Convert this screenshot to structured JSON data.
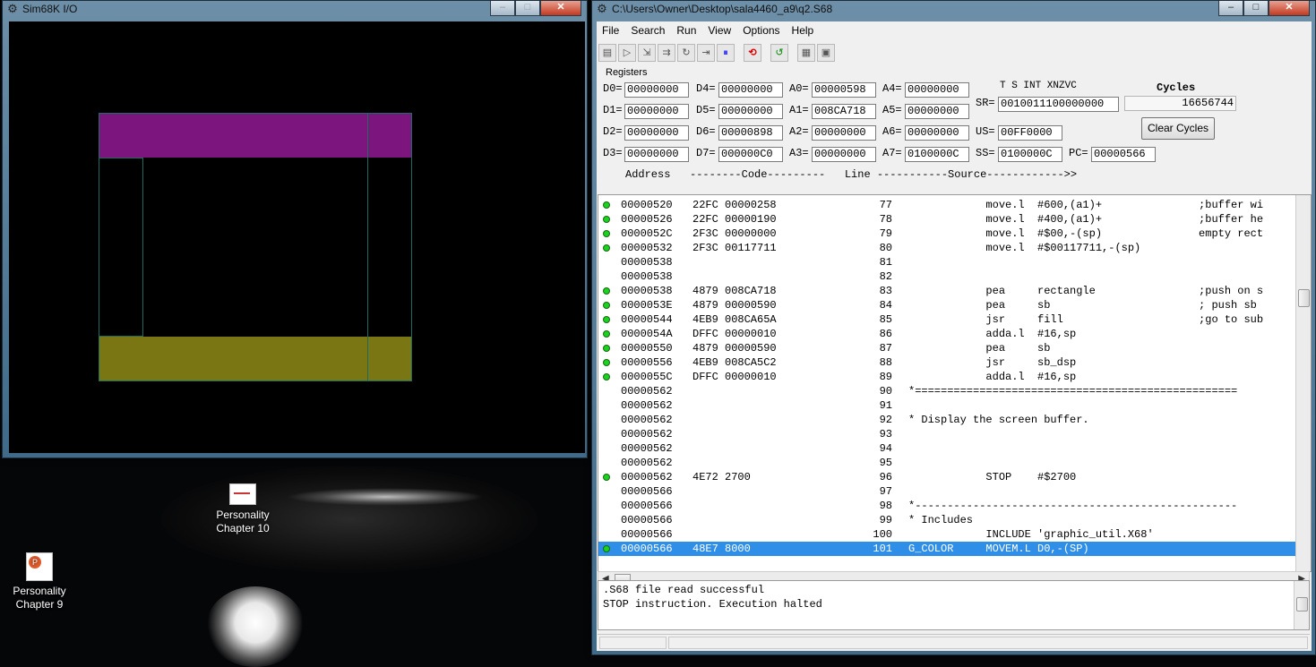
{
  "io_window": {
    "title": "Sim68K I/O",
    "colors": {
      "magenta": "#7d157f",
      "olive": "#7a7613",
      "teal_line": "#1c6b5f"
    }
  },
  "editor_window": {
    "title": "C:\\Users\\Owner\\Desktop\\sala4460_a9\\q2.S68",
    "menu": [
      "File",
      "Search",
      "Run",
      "View",
      "Options",
      "Help"
    ],
    "registers": {
      "group_label": "Registers",
      "data": [
        {
          "name": "D0=",
          "value": "00000000"
        },
        {
          "name": "D1=",
          "value": "00000000"
        },
        {
          "name": "D2=",
          "value": "00000000"
        },
        {
          "name": "D3=",
          "value": "00000000"
        },
        {
          "name": "D4=",
          "value": "00000000"
        },
        {
          "name": "D5=",
          "value": "00000000"
        },
        {
          "name": "D6=",
          "value": "00000898"
        },
        {
          "name": "D7=",
          "value": "000000C0"
        }
      ],
      "address": [
        {
          "name": "A0=",
          "value": "00000598"
        },
        {
          "name": "A1=",
          "value": "008CA718"
        },
        {
          "name": "A2=",
          "value": "00000000"
        },
        {
          "name": "A3=",
          "value": "00000000"
        },
        {
          "name": "A4=",
          "value": "00000000"
        },
        {
          "name": "A5=",
          "value": "00000000"
        },
        {
          "name": "A6=",
          "value": "00000000"
        },
        {
          "name": "A7=",
          "value": "0100000C"
        }
      ],
      "flags_header": "T S   INT   XNZVC",
      "sr_label": "SR=",
      "sr_value": "0010011100000000",
      "us_label": "US=",
      "us_value": "00FF0000",
      "ss_label": "SS=",
      "ss_value": "0100000C",
      "pc_label": "PC=",
      "pc_value": "00000566",
      "cycles_label": "Cycles",
      "cycles_value": "16656744",
      "clear_cycles_label": "Clear Cycles"
    },
    "listing_header": "Address   --------Code---------   Line -----------Source------------>>",
    "listing": [
      {
        "bp": true,
        "addr": "00000520",
        "code": "22FC 00000258",
        "line": "77",
        "src": "            move.l  #600,(a1)+               ;buffer wi"
      },
      {
        "bp": true,
        "addr": "00000526",
        "code": "22FC 00000190",
        "line": "78",
        "src": "            move.l  #400,(a1)+               ;buffer he"
      },
      {
        "bp": true,
        "addr": "0000052C",
        "code": "2F3C 00000000",
        "line": "79",
        "src": "            move.l  #$00,-(sp)               empty rect"
      },
      {
        "bp": true,
        "addr": "00000532",
        "code": "2F3C 00117711",
        "line": "80",
        "src": "            move.l  #$00117711,-(sp)"
      },
      {
        "bp": false,
        "addr": "00000538",
        "code": "",
        "line": "81",
        "src": ""
      },
      {
        "bp": false,
        "addr": "00000538",
        "code": "",
        "line": "82",
        "src": ""
      },
      {
        "bp": true,
        "addr": "00000538",
        "code": "4879 008CA718",
        "line": "83",
        "src": "            pea     rectangle                ;push on s"
      },
      {
        "bp": true,
        "addr": "0000053E",
        "code": "4879 00000590",
        "line": "84",
        "src": "            pea     sb                       ; push sb"
      },
      {
        "bp": true,
        "addr": "00000544",
        "code": "4EB9 008CA65A",
        "line": "85",
        "src": "            jsr     fill                     ;go to sub"
      },
      {
        "bp": true,
        "addr": "0000054A",
        "code": "DFFC 00000010",
        "line": "86",
        "src": "            adda.l  #16,sp"
      },
      {
        "bp": true,
        "addr": "00000550",
        "code": "4879 00000590",
        "line": "87",
        "src": "            pea     sb"
      },
      {
        "bp": true,
        "addr": "00000556",
        "code": "4EB9 008CA5C2",
        "line": "88",
        "src": "            jsr     sb_dsp"
      },
      {
        "bp": true,
        "addr": "0000055C",
        "code": "DFFC 00000010",
        "line": "89",
        "src": "            adda.l  #16,sp"
      },
      {
        "bp": false,
        "addr": "00000562",
        "code": "",
        "line": "90",
        "src": "*=================================================="
      },
      {
        "bp": false,
        "addr": "00000562",
        "code": "",
        "line": "91",
        "src": ""
      },
      {
        "bp": false,
        "addr": "00000562",
        "code": "",
        "line": "92",
        "src": "* Display the screen buffer."
      },
      {
        "bp": false,
        "addr": "00000562",
        "code": "",
        "line": "93",
        "src": ""
      },
      {
        "bp": false,
        "addr": "00000562",
        "code": "",
        "line": "94",
        "src": ""
      },
      {
        "bp": false,
        "addr": "00000562",
        "code": "",
        "line": "95",
        "src": ""
      },
      {
        "bp": true,
        "addr": "00000562",
        "code": "4E72 2700",
        "line": "96",
        "src": "            STOP    #$2700"
      },
      {
        "bp": false,
        "addr": "00000566",
        "code": "",
        "line": "97",
        "src": ""
      },
      {
        "bp": false,
        "addr": "00000566",
        "code": "",
        "line": "98",
        "src": "*--------------------------------------------------"
      },
      {
        "bp": false,
        "addr": "00000566",
        "code": "",
        "line": "99",
        "src": "* Includes"
      },
      {
        "bp": false,
        "addr": "00000566",
        "code": "",
        "line": "100",
        "src": "            INCLUDE 'graphic_util.X68'"
      },
      {
        "bp": true,
        "addr": "00000566",
        "code": "48E7 8000",
        "line": "101",
        "src": "G_COLOR     MOVEM.L D0,-(SP)",
        "selected": true
      }
    ],
    "messages": [
      ".S68 file read successful",
      "STOP instruction. Execution halted"
    ]
  },
  "desktop_icons": [
    {
      "label": "Personality Chapter 10"
    },
    {
      "label": "Personality Chapter 9"
    }
  ]
}
